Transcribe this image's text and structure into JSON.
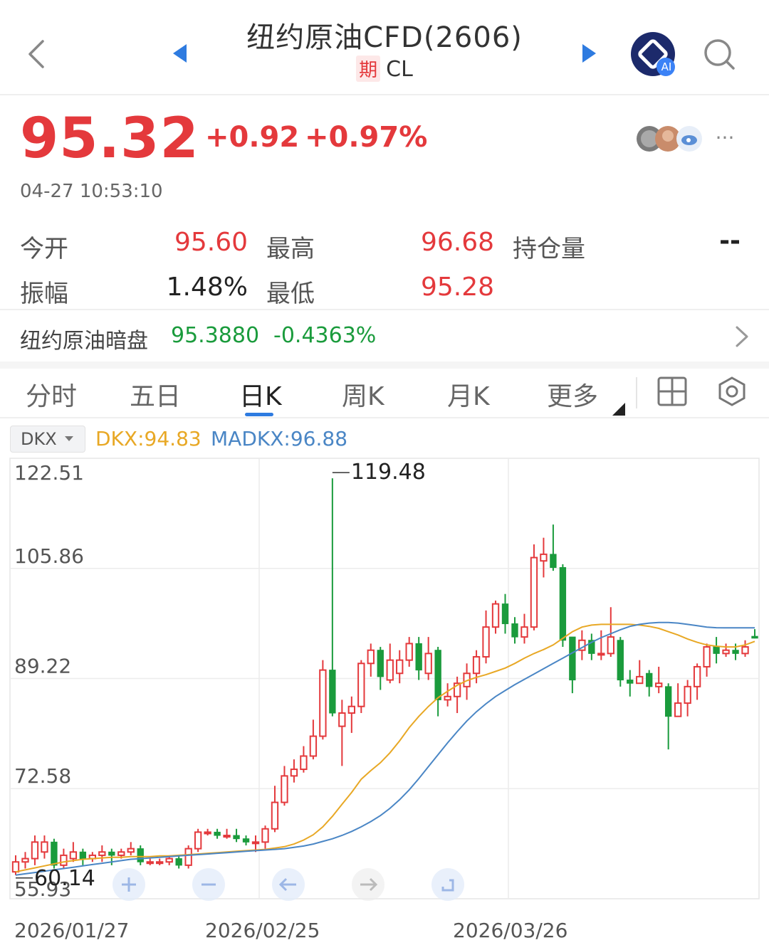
{
  "header": {
    "title": "纽约原油CFD(2606)",
    "type_tag": "期",
    "symbol": "CL",
    "ai_badge": "AI"
  },
  "quote": {
    "price": "95.32",
    "change": "+0.92",
    "change_pct": "+0.97%",
    "timestamp": "04-27 10:53:10",
    "more_label": "···"
  },
  "stats": {
    "open_label": "今开",
    "open_value": "95.60",
    "high_label": "最高",
    "high_value": "96.68",
    "oi_label": "持仓量",
    "oi_value": "--",
    "amp_label": "振幅",
    "amp_value": "1.48%",
    "low_label": "最低",
    "low_value": "95.28"
  },
  "dark_pool": {
    "label": "纽约原油暗盘",
    "value": "95.3880",
    "change_pct": "-0.4363%"
  },
  "tabs": [
    {
      "label": "分时"
    },
    {
      "label": "五日"
    },
    {
      "label": "日K"
    },
    {
      "label": "周K"
    },
    {
      "label": "月K"
    },
    {
      "label": "更多"
    }
  ],
  "indicator": {
    "selector_label": "DKX",
    "dkx_text": "DKX:94.83",
    "madkx_text": "MADKX:96.88"
  },
  "colors": {
    "up": "#e4393c",
    "down": "#1a9b3c",
    "dkx_line": "#e8a825",
    "madkx_line": "#4a86c5"
  },
  "chart_data": {
    "type": "candlestick",
    "y_ticks": [
      "122.51",
      "105.86",
      "89.22",
      "72.58",
      "55.93"
    ],
    "ylim": [
      55.93,
      122.51
    ],
    "x_ticks": [
      "2026/01/27",
      "2026/02/25",
      "2026/03/26"
    ],
    "max_label": "119.48",
    "min_label": "60.14",
    "series": [
      {
        "name": "DKX",
        "values": [
          60.0,
          60.3,
          60.6,
          60.9,
          61.2,
          61.5,
          61.7,
          61.9,
          62.0,
          62.1,
          62.2,
          62.2,
          62.3,
          62.3,
          62.3,
          62.4,
          62.4,
          62.5,
          62.6,
          62.7,
          62.8,
          62.9,
          63.0,
          63.1,
          63.2,
          63.3,
          63.4,
          63.6,
          63.8,
          64.2,
          64.8,
          65.6,
          66.8,
          68.4,
          70.2,
          72.0,
          74.0,
          75.3,
          76.5,
          78.0,
          79.8,
          81.8,
          83.5,
          85.0,
          86.3,
          87.3,
          88.2,
          88.9,
          89.4,
          89.8,
          90.3,
          90.8,
          91.5,
          92.3,
          93.0,
          93.6,
          94.3,
          95.3,
          96.3,
          97.0,
          97.3,
          97.4,
          97.4,
          97.4,
          97.4,
          97.3,
          97.1,
          96.8,
          96.3,
          95.8,
          95.2,
          94.7,
          94.3,
          94.1,
          94.0,
          94.0,
          94.3,
          94.83
        ]
      },
      {
        "name": "MADKX",
        "values": [
          59.5,
          59.7,
          59.9,
          60.1,
          60.3,
          60.5,
          60.7,
          60.9,
          61.1,
          61.3,
          61.5,
          61.7,
          61.9,
          62.0,
          62.1,
          62.2,
          62.3,
          62.4,
          62.5,
          62.6,
          62.7,
          62.8,
          62.9,
          63.0,
          63.1,
          63.2,
          63.3,
          63.4,
          63.5,
          63.7,
          63.9,
          64.2,
          64.6,
          65.0,
          65.5,
          66.1,
          66.8,
          67.6,
          68.5,
          69.6,
          70.9,
          72.4,
          74.1,
          75.9,
          77.7,
          79.5,
          81.2,
          82.8,
          84.2,
          85.4,
          86.5,
          87.4,
          88.3,
          89.1,
          89.9,
          90.7,
          91.5,
          92.3,
          93.1,
          93.9,
          94.7,
          95.4,
          96.0,
          96.6,
          97.1,
          97.4,
          97.6,
          97.7,
          97.7,
          97.6,
          97.4,
          97.2,
          97.0,
          96.9,
          96.88,
          96.88,
          96.88,
          96.88
        ]
      }
    ],
    "candles": [
      [
        60.0,
        61.5,
        62.5,
        59.5
      ],
      [
        61.5,
        62.0,
        63.0,
        60.5
      ],
      [
        62.0,
        64.5,
        65.5,
        61.0
      ],
      [
        63.0,
        64.5,
        65.5,
        62.0
      ],
      [
        64.5,
        61.0,
        65.0,
        60.5
      ],
      [
        61.0,
        62.5,
        63.5,
        60.5
      ],
      [
        62.0,
        63.0,
        64.5,
        61.5
      ],
      [
        63.0,
        62.0,
        63.5,
        61.0
      ],
      [
        62.0,
        62.5,
        63.0,
        61.5
      ],
      [
        62.5,
        63.0,
        64.0,
        61.5
      ],
      [
        63.0,
        62.5,
        63.5,
        61.0
      ],
      [
        62.5,
        63.0,
        63.5,
        62.0
      ],
      [
        63.0,
        63.5,
        64.5,
        62.5
      ],
      [
        63.5,
        61.5,
        64.0,
        61.0
      ],
      [
        61.5,
        61.5,
        62.0,
        61.0
      ],
      [
        61.5,
        61.5,
        62.0,
        61.0
      ],
      [
        61.5,
        62.0,
        62.5,
        61.0
      ],
      [
        62.0,
        61.0,
        62.5,
        60.5
      ],
      [
        61.0,
        63.5,
        64.0,
        60.5
      ],
      [
        63.5,
        66.0,
        66.5,
        63.0
      ],
      [
        66.0,
        66.0,
        66.5,
        65.5
      ],
      [
        66.0,
        65.5,
        66.5,
        65.0
      ],
      [
        65.5,
        65.5,
        66.5,
        65.0
      ],
      [
        65.5,
        65.0,
        66.5,
        64.5
      ],
      [
        65.0,
        64.5,
        65.5,
        64.0
      ],
      [
        64.5,
        64.5,
        65.5,
        63.0
      ],
      [
        64.5,
        66.5,
        67.0,
        63.5
      ],
      [
        66.5,
        70.5,
        73.0,
        66.0
      ],
      [
        70.5,
        74.5,
        76.0,
        70.0
      ],
      [
        74.5,
        75.5,
        77.0,
        73.5
      ],
      [
        75.5,
        77.5,
        79.0,
        75.0
      ],
      [
        77.5,
        80.5,
        83.0,
        77.0
      ],
      [
        80.5,
        90.5,
        92.0,
        80.0
      ],
      [
        90.5,
        84.0,
        119.48,
        83.5
      ],
      [
        82.0,
        84.0,
        86.0,
        76.0
      ],
      [
        84.0,
        85.0,
        86.5,
        81.0
      ],
      [
        85.0,
        91.5,
        92.0,
        84.0
      ],
      [
        91.5,
        93.5,
        94.5,
        89.5
      ],
      [
        93.5,
        89.5,
        94.0,
        87.5
      ],
      [
        89.0,
        92.0,
        94.5,
        88.5
      ],
      [
        90.0,
        92.0,
        93.5,
        88.5
      ],
      [
        92.0,
        94.5,
        95.5,
        91.0
      ],
      [
        94.5,
        90.5,
        95.5,
        89.0
      ],
      [
        90.0,
        93.0,
        95.5,
        89.0
      ],
      [
        93.5,
        86.0,
        94.0,
        83.5
      ],
      [
        86.0,
        86.5,
        88.5,
        85.0
      ],
      [
        86.5,
        88.5,
        89.5,
        84.0
      ],
      [
        88.0,
        90.0,
        91.5,
        86.0
      ],
      [
        90.0,
        92.5,
        93.5,
        88.5
      ],
      [
        92.5,
        97.0,
        99.5,
        91.5
      ],
      [
        97.0,
        100.5,
        101.0,
        96.0
      ],
      [
        100.5,
        97.5,
        102.0,
        96.0
      ],
      [
        97.5,
        95.5,
        98.5,
        94.5
      ],
      [
        95.5,
        97.0,
        99.0,
        94.5
      ],
      [
        97.0,
        107.5,
        109.5,
        96.5
      ],
      [
        107.0,
        108.0,
        110.5,
        104.5
      ],
      [
        108.0,
        106.0,
        112.5,
        105.5
      ],
      [
        106.0,
        95.0,
        106.5,
        94.0
      ],
      [
        95.5,
        89.0,
        95.5,
        87.0
      ],
      [
        93.5,
        95.0,
        96.5,
        92.0
      ],
      [
        95.0,
        93.0,
        96.0,
        92.0
      ],
      [
        93.0,
        93.0,
        96.5,
        92.0
      ],
      [
        93.0,
        95.5,
        100.0,
        92.5
      ],
      [
        95.0,
        89.0,
        95.5,
        88.0
      ],
      [
        89.0,
        88.5,
        90.5,
        86.5
      ],
      [
        88.5,
        89.5,
        92.0,
        88.5
      ],
      [
        90.0,
        88.0,
        90.5,
        86.5
      ],
      [
        88.0,
        88.5,
        91.0,
        87.0
      ],
      [
        88.0,
        83.5,
        88.5,
        78.5
      ],
      [
        83.5,
        85.5,
        88.5,
        83.5
      ],
      [
        85.5,
        88.0,
        89.0,
        83.5
      ],
      [
        88.0,
        91.0,
        91.5,
        86.0
      ],
      [
        91.0,
        94.0,
        94.5,
        89.5
      ],
      [
        94.0,
        93.0,
        95.5,
        91.5
      ],
      [
        93.0,
        93.5,
        94.5,
        92.5
      ],
      [
        93.5,
        93.0,
        94.5,
        92.0
      ],
      [
        93.0,
        94.0,
        95.0,
        92.5
      ],
      [
        95.6,
        95.32,
        96.68,
        95.28
      ]
    ]
  }
}
